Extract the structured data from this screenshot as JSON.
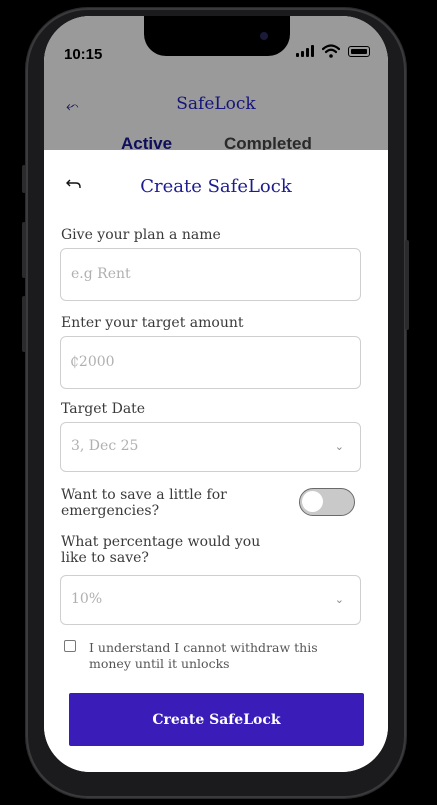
{
  "status": {
    "time": "10:15"
  },
  "background_screen": {
    "title": "SafeLock",
    "tabs": [
      {
        "label": "Active"
      },
      {
        "label": "Completed"
      }
    ]
  },
  "sheet": {
    "title": "Create SafeLock",
    "name_field": {
      "label": "Give your plan a name",
      "placeholder": "e.g Rent"
    },
    "amount_field": {
      "label": "Enter your target amount",
      "placeholder": "₵2000"
    },
    "date_field": {
      "label": "Target Date",
      "value": "3, Dec 25"
    },
    "emergency_toggle": {
      "label": "Want to save a little for emergencies?",
      "on": false
    },
    "percentage_field": {
      "label": "What percentage would you like to save?",
      "value": "10%"
    },
    "agreement": {
      "text": "I understand I cannot withdraw this money until it unlocks",
      "checked": false
    },
    "submit_label": "Create SafeLock"
  },
  "colors": {
    "accent": "#3a1cb8",
    "title": "#1c1c8f",
    "overlay": "#9a9a9a"
  }
}
